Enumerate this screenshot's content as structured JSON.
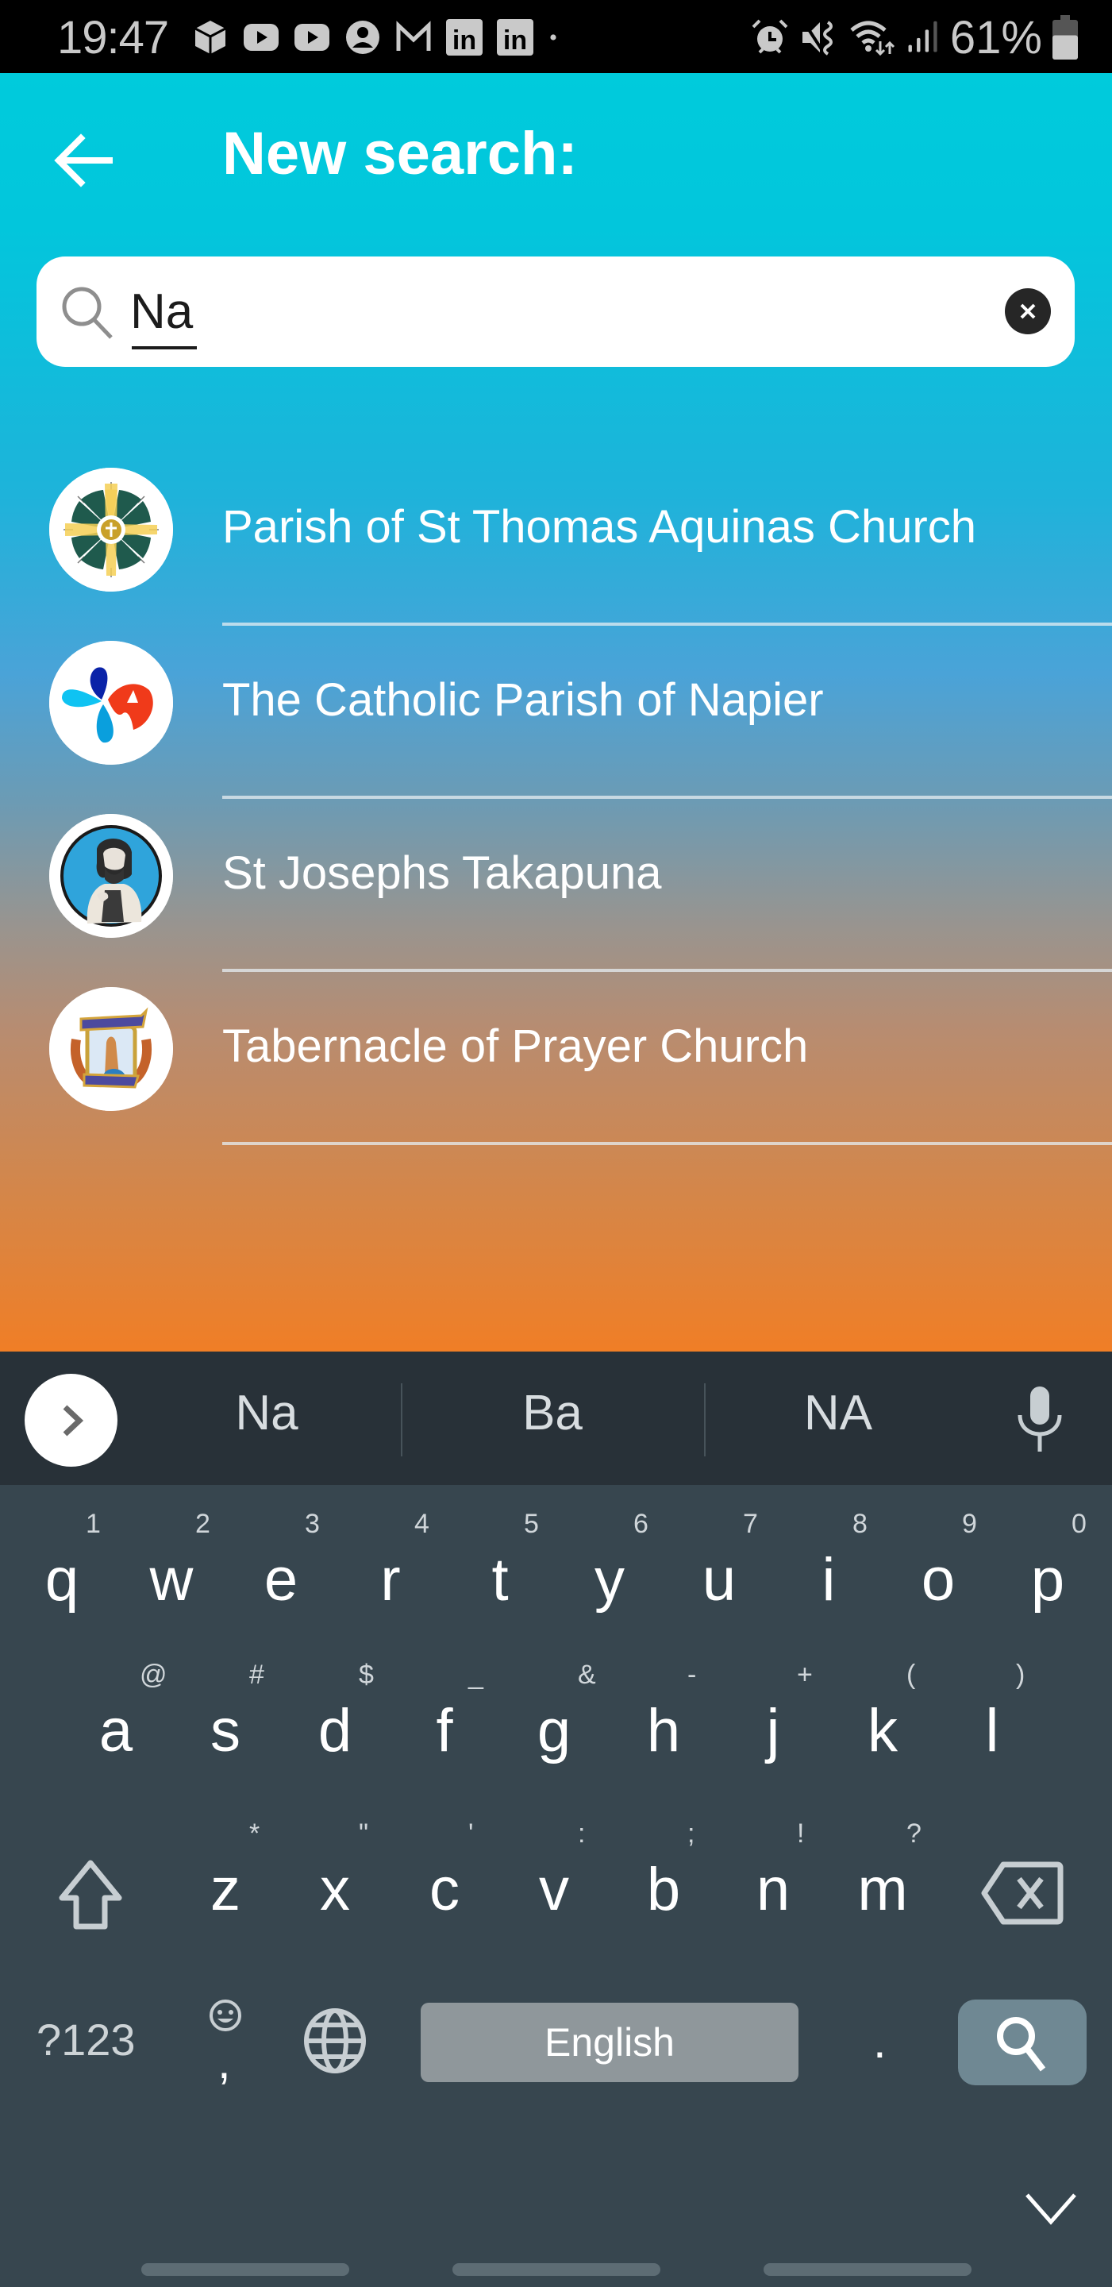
{
  "status_bar": {
    "time": "19:47",
    "left_icons": [
      "package-icon",
      "youtube-icon",
      "youtube-icon",
      "account-icon",
      "gmail-icon",
      "linkedin-icon",
      "linkedin-icon",
      "dot-icon"
    ],
    "right_icons": [
      "alarm-icon",
      "vibrate-icon",
      "wifi-icon",
      "signal-icon"
    ],
    "battery_percent": "61%",
    "battery_level": 0.61
  },
  "header": {
    "back_icon": "arrow-left-icon",
    "title": "New search:"
  },
  "search": {
    "icon": "search-icon",
    "value": "Na",
    "clear_icon": "close-icon"
  },
  "results": [
    {
      "label": "Parish of St Thomas Aquinas Church",
      "avatar": "sunburst-cross-logo"
    },
    {
      "label": "The Catholic Parish of Napier",
      "avatar": "droplets-dove-logo"
    },
    {
      "label": "St Josephs Takapuna",
      "avatar": "st-joseph-portrait-logo"
    },
    {
      "label": "Tabernacle of Prayer Church",
      "avatar": "praying-hands-crest-logo"
    }
  ],
  "keyboard": {
    "suggestions": [
      "Na",
      "Ba",
      "NA"
    ],
    "row1": [
      {
        "key": "q",
        "hint": "1"
      },
      {
        "key": "w",
        "hint": "2"
      },
      {
        "key": "e",
        "hint": "3"
      },
      {
        "key": "r",
        "hint": "4"
      },
      {
        "key": "t",
        "hint": "5"
      },
      {
        "key": "y",
        "hint": "6"
      },
      {
        "key": "u",
        "hint": "7"
      },
      {
        "key": "i",
        "hint": "8"
      },
      {
        "key": "o",
        "hint": "9"
      },
      {
        "key": "p",
        "hint": "0"
      }
    ],
    "row2": [
      {
        "key": "a",
        "hint": "@"
      },
      {
        "key": "s",
        "hint": "#"
      },
      {
        "key": "d",
        "hint": "$"
      },
      {
        "key": "f",
        "hint": "_"
      },
      {
        "key": "g",
        "hint": "&"
      },
      {
        "key": "h",
        "hint": "-"
      },
      {
        "key": "j",
        "hint": "+"
      },
      {
        "key": "k",
        "hint": "("
      },
      {
        "key": "l",
        "hint": ")"
      }
    ],
    "row3": [
      {
        "key": "z",
        "hint": "*"
      },
      {
        "key": "x",
        "hint": "\""
      },
      {
        "key": "c",
        "hint": "'"
      },
      {
        "key": "v",
        "hint": ":"
      },
      {
        "key": "b",
        "hint": ";"
      },
      {
        "key": "n",
        "hint": "!"
      },
      {
        "key": "m",
        "hint": "?"
      }
    ],
    "symbols_label": "?123",
    "comma_key": ",",
    "comma_hint": "emoji",
    "space_label": "English",
    "period_key": ".",
    "action_icon": "search-icon"
  },
  "colors": {
    "gradient_top": "#00cbdc",
    "gradient_bottom": "#f07e26",
    "keyboard_bg": "#37464f",
    "suggestion_bg": "#283138",
    "action_key": "#6f8893",
    "space_key": "#8f979b"
  }
}
